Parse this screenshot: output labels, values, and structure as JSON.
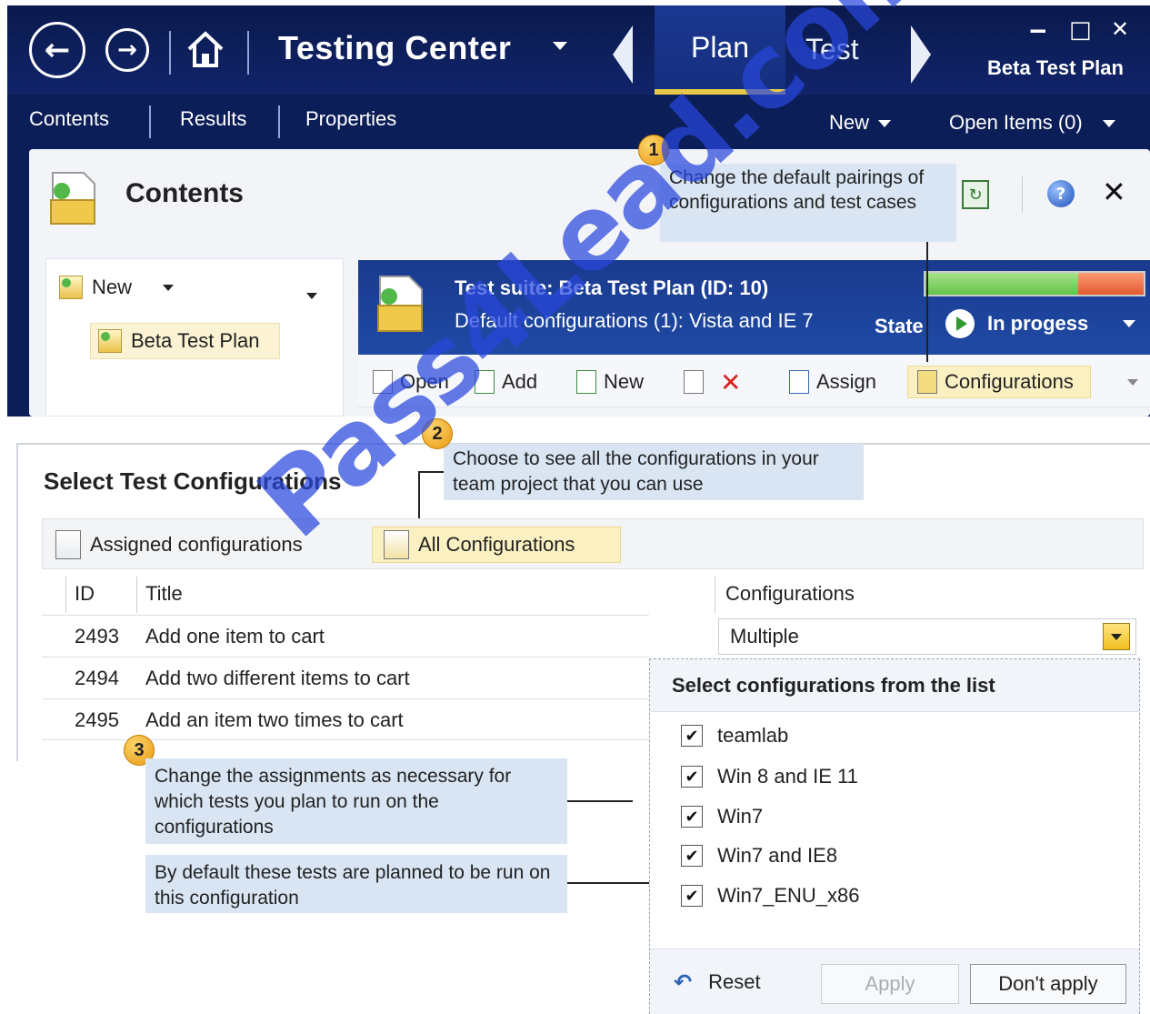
{
  "window": {
    "app_title": "Testing Center",
    "tabs": [
      {
        "label": "Plan",
        "active": true
      },
      {
        "label": "Test",
        "active": false
      }
    ],
    "plan_name": "Beta Test Plan",
    "controls": {
      "minimize": "‒",
      "maximize": "□",
      "close": "✕"
    }
  },
  "subnav": {
    "items": [
      "Contents",
      "Results",
      "Properties"
    ],
    "new_label": "New",
    "open_items_label": "Open Items (0)"
  },
  "contents": {
    "title": "Contents",
    "tree_new_label": "New",
    "tree_item": "Beta Test Plan"
  },
  "suite": {
    "title": "Test suite:  Beta Test Plan (ID: 10)",
    "default_configs": "Default configurations (1): Vista and IE 7",
    "state_label": "State",
    "state_value": "In progess",
    "progress": {
      "passed_fraction": 0.7,
      "failed_fraction": 0.3
    },
    "toolbar": [
      "Open",
      "Add",
      "New",
      "Assign",
      "Configurations"
    ]
  },
  "callouts": [
    {
      "number": "1",
      "text": "Change the default pairings of configurations and test cases"
    },
    {
      "number": "2",
      "text": "Choose to see all the configurations in your team project that you can use"
    },
    {
      "number": "3",
      "text": "Change the assignments as necessary for which tests you plan to run on the configurations"
    },
    {
      "number": "",
      "text": "By default these tests are planned to be run on this configuration"
    }
  ],
  "dialog": {
    "title": "Select Test Configurations",
    "toolbar": {
      "assigned": "Assigned configurations",
      "all": "All Configurations"
    },
    "columns": {
      "id": "ID",
      "title": "Title",
      "configurations": "Configurations"
    },
    "rows": [
      {
        "id": "2493",
        "title": "Add one item to cart"
      },
      {
        "id": "2494",
        "title": "Add two different items to cart"
      },
      {
        "id": "2495",
        "title": "Add an item two times to cart"
      }
    ],
    "configurations_value": "Multiple"
  },
  "config_popup": {
    "title": "Select configurations from the list",
    "items": [
      {
        "label": "teamlab",
        "checked": true
      },
      {
        "label": "Win 8 and IE 11",
        "checked": true
      },
      {
        "label": "Win7",
        "checked": true
      },
      {
        "label": "Win7 and IE8",
        "checked": true
      },
      {
        "label": "Win7_ENU_x86",
        "checked": true
      }
    ],
    "reset_label": "Reset",
    "apply_label": "Apply",
    "dont_apply_label": "Don't apply"
  },
  "watermark": "Pass4Lead.com",
  "colors": {
    "app_bg": "#0c1e57",
    "accent_gold": "#e8c84a",
    "callout_bg": "#d9e5f3",
    "watermark": "#2846dc"
  }
}
